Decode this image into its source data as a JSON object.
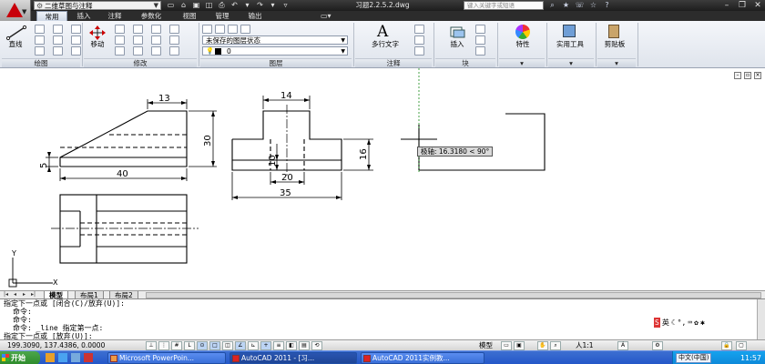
{
  "titlebar": {
    "workspace": "二维草图与注释",
    "doc_title": "习题2.2.5.2.dwg",
    "search_placeholder": "键入关键字或短语"
  },
  "tabs": [
    {
      "label": "常用"
    },
    {
      "label": "插入"
    },
    {
      "label": "注释"
    },
    {
      "label": "参数化"
    },
    {
      "label": "视图"
    },
    {
      "label": "管理"
    },
    {
      "label": "输出"
    }
  ],
  "ribbon": {
    "draw_panel": "绘图",
    "modify_panel": "修改",
    "layer_panel": "图层",
    "annotation_panel": "注释",
    "block_panel": "块",
    "line_label": "直线",
    "move_label": "移动",
    "layer_state": "未保存的图层状态",
    "layer_current": "0",
    "mtext_label": "多行文字",
    "insert_label": "插入",
    "properties_label": "特性",
    "utilities_label": "实用工具",
    "clipboard_label": "剪贴板"
  },
  "drawing": {
    "dims": {
      "d13": "13",
      "d30": "30",
      "d5": "5",
      "d40": "40",
      "d14": "14",
      "d10": "10",
      "d16": "16",
      "d20": "20",
      "d35": "35"
    },
    "tooltip": "极轴: 16.3180 < 90°",
    "ucs_x": "X",
    "ucs_y": "Y"
  },
  "layout_tabs": [
    {
      "label": "模型",
      "active": true
    },
    {
      "label": "布局1",
      "active": false
    },
    {
      "label": "布局2",
      "active": false
    }
  ],
  "command": {
    "lines": [
      "指定下一点或 [闭合(C)/放弃(U)]:",
      "命令:",
      "命令:",
      "命令: _line 指定第一点:",
      "指定下一点或 [放弃(U)]:"
    ]
  },
  "statusbar": {
    "coords": "199.3090, 137.4386, 0.0000",
    "model": "模型",
    "scale": "人1:1"
  },
  "taskbar": {
    "start": "开始",
    "tasks": [
      {
        "label": "Microsoft PowerPoin..."
      },
      {
        "label": "AutoCAD 2011 - [习..."
      },
      {
        "label": "AutoCAD 2011实例教..."
      }
    ],
    "ime": "中文(中国)",
    "clock": "11:57"
  },
  "colors": {
    "accent": "#2457c8",
    "logo_red": "#c8000a",
    "polar_track": "#1a8a1a"
  }
}
